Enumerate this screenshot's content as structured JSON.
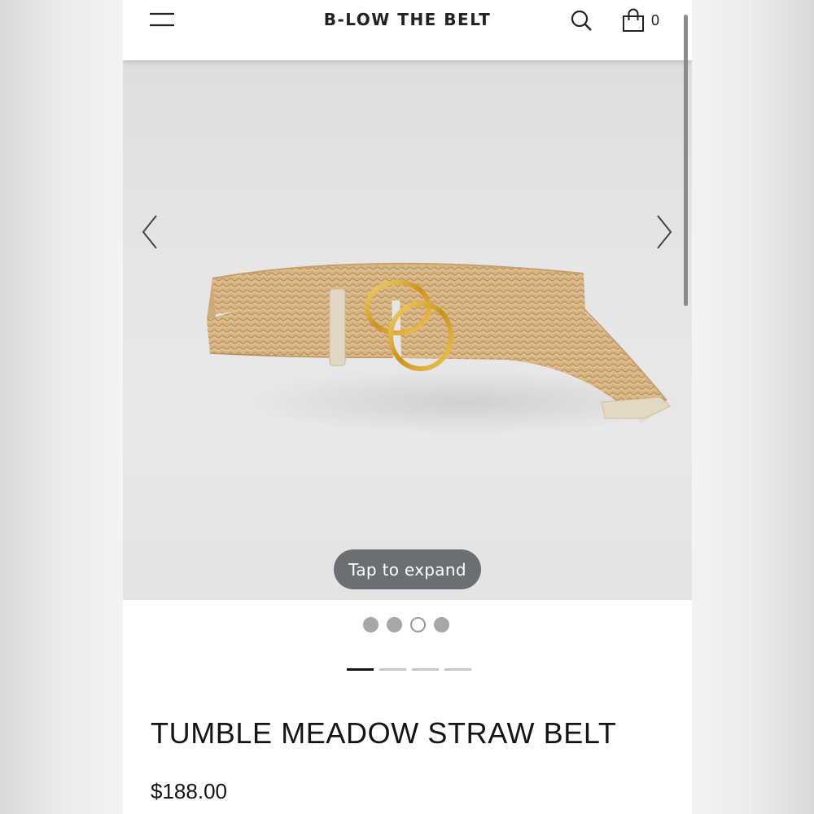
{
  "header": {
    "brand": "B-LOW THE BELT",
    "cart_count": "0"
  },
  "gallery": {
    "expand_label": "Tap to expand",
    "image_name": "tumble-meadow-straw-belt-photo",
    "dots": [
      {
        "active": false
      },
      {
        "active": false
      },
      {
        "active": true
      },
      {
        "active": false
      }
    ],
    "lines": [
      {
        "active": true
      },
      {
        "active": false
      },
      {
        "active": false
      },
      {
        "active": false
      }
    ]
  },
  "product": {
    "title": "TUMBLE MEADOW STRAW BELT",
    "price": "$188.00"
  },
  "colors": {
    "straw": "#dcb98a",
    "buckle_gold": "#d9a52a",
    "leather_tab": "#e2d7c2",
    "pill_bg": "#6b6e73"
  },
  "icons": [
    "menu-icon",
    "search-icon",
    "shopping-bag-icon",
    "chevron-left-icon",
    "chevron-right-icon"
  ]
}
